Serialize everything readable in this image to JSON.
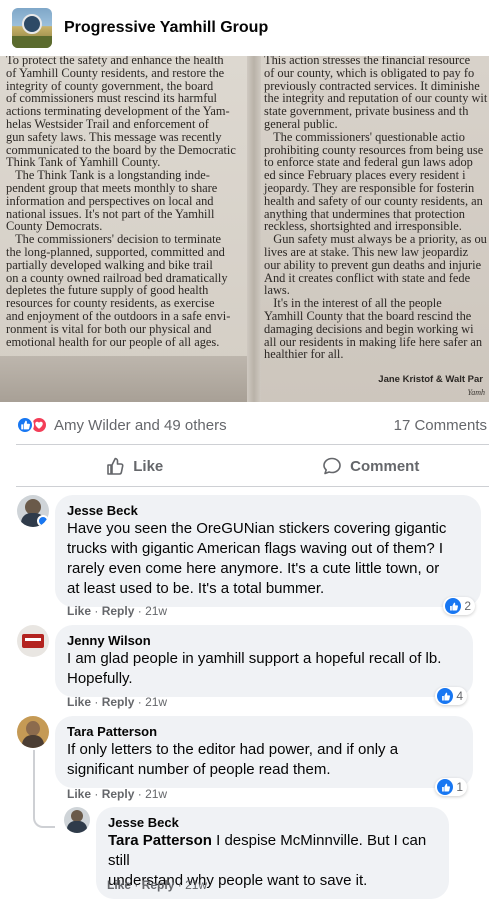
{
  "group": {
    "name": "Progressive Yamhill Group"
  },
  "article": {
    "left_column": [
      "To protect the safety and enhance the health",
      "of Yamhill County residents, and restore the",
      "integrity of county government, the board",
      "of commissioners must rescind its harmful",
      "actions terminating development of the Yam-",
      "helas Westsider Trail and enforcement of",
      "gun safety laws. This message was recently",
      "communicated to the board by the Democratic",
      "Think Tank of Yamhill County.",
      "   The Think Tank is a longstanding inde-",
      "pendent group that meets monthly to share",
      "information and perspectives on local and",
      "national issues. It's not part of the Yamhill",
      "County Democrats.",
      "   The commissioners' decision to terminate",
      "the long-planned, supported, committed and",
      "partially developed walking and bike trail",
      "on a county owned railroad bed dramatically",
      "depletes the future supply of good health",
      "resources for county residents, as exercise",
      "and enjoyment of the outdoors in a safe envi-",
      "ronment is vital for both our physical and",
      "emotional health for our people of all ages."
    ],
    "right_column": [
      "This action stresses the financial resource",
      "of our county, which is obligated to pay fo",
      "previously contracted services. It diminishe",
      "the integrity and reputation of our county wit",
      "state government, private business and th",
      "general public.",
      "   The commissioners' questionable actio",
      "prohibiting county resources from being use",
      "to enforce state and federal gun laws adop",
      "ed since February places every resident i",
      "jeopardy. They are responsible for fosterin",
      "health and safety of our county residents, an",
      "anything that undermines that protection",
      "reckless, shortsighted and irresponsible.",
      "   Gun safety must always be a priority, as ou",
      "lives are at stake. This new law jeopardiz",
      "our ability to prevent gun deaths and injurie",
      "And it creates conflict with state and fede",
      "laws.",
      "   It's in the interest of all the people",
      "Yamhill County that the board rescind the",
      "damaging decisions and begin working wi",
      "all our residents in making life here safer an",
      "healthier for all."
    ],
    "signature": "Jane Kristof & Walt Par",
    "signature_sub": "Yamh"
  },
  "reactions": {
    "reactors": "Amy Wilder and 49 others",
    "comment_count": "17 Comments"
  },
  "actions": {
    "like_label": "Like",
    "comment_label": "Comment"
  },
  "comments": [
    {
      "author": "Jesse Beck",
      "lines": [
        "Have you seen the OreGUNian stickers covering gigantic",
        "trucks with gigantic American flags waving out of them? I",
        "rarely even come here anymore. It's a cute little town, or",
        "at least used to be. It's a total bummer."
      ],
      "like": "Like",
      "reply": "Reply",
      "time": "21w",
      "reactions": "2"
    },
    {
      "author": "Jenny Wilson",
      "lines": [
        "I am glad people in yamhill support a hopeful recall of lb.",
        "Hopefully."
      ],
      "like": "Like",
      "reply": "Reply",
      "time": "21w",
      "reactions": "4"
    },
    {
      "author": "Tara Patterson",
      "lines": [
        "If only letters to the editor had power, and if only a",
        "significant number of people read them."
      ],
      "like": "Like",
      "reply": "Reply",
      "time": "21w",
      "reactions": "1"
    },
    {
      "author": "Jesse Beck",
      "tag": "Tara Patterson",
      "first_line_rest": " I despise McMinnville. But I can still",
      "lines": [
        "understand why people want to save it."
      ],
      "like": "Like",
      "reply": "Reply",
      "time": "21w"
    }
  ],
  "meta_separator": "·"
}
